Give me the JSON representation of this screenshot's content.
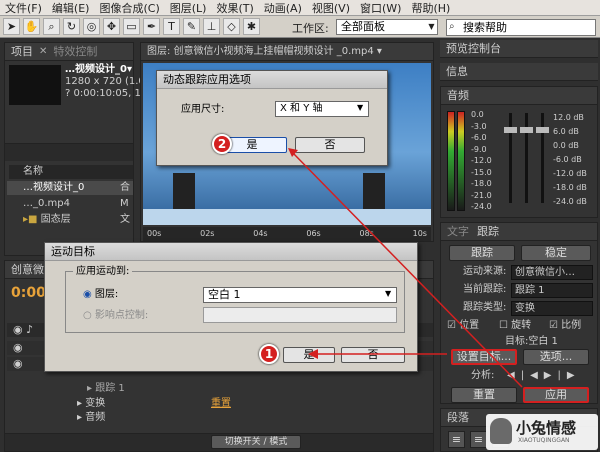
{
  "menu": [
    "文件(F)",
    "编辑(E)",
    "图像合成(C)",
    "图层(L)",
    "效果(T)",
    "动画(A)",
    "视图(V)",
    "窗口(W)",
    "帮助(H)"
  ],
  "toolbar": {
    "workspace_label": "工作区:",
    "workspace_value": "全部面板",
    "search_placeholder": "搜索帮助"
  },
  "project": {
    "tab1": "项目",
    "tab2": "特效控制",
    "thumb_name": "…视频设计_0▾",
    "thumb_size": "1280 x 720 (1.00)",
    "thumb_dur": "? 0:00:10:05, 15…",
    "col_name": "名称",
    "items": [
      {
        "name": "…视频设计_0",
        "type": "合"
      },
      {
        "name": "…_0.mp4",
        "type": "M"
      },
      {
        "name": "固态层",
        "type": "文"
      }
    ]
  },
  "viewer": {
    "tab": "图层: 创意微信小视频海上挂帽帽视频设计 _0.mp4 ▾",
    "ruler": [
      "00s",
      "02s",
      "04s",
      "06s",
      "08s",
      "10s"
    ]
  },
  "right": {
    "preview_tab": "预览控制台",
    "info_tab": "信息",
    "audio_tab": "音频",
    "db_left": [
      "0.0",
      "-3.0",
      "-6.0",
      "-9.0",
      "-12.0",
      "-15.0",
      "-18.0",
      "-21.0",
      "-24.0"
    ],
    "db_right": [
      "12.0 dB",
      "6.0 dB",
      "0.0 dB",
      "-6.0 dB",
      "-12.0 dB",
      "-18.0 dB",
      "-24.0 dB"
    ]
  },
  "tracker": {
    "tab_text": "文字",
    "tab_tracker": "跟踪",
    "track_btn": "跟踪",
    "stabilize_btn": "稳定",
    "source_label": "运动来源:",
    "source_value": "创意微信小…",
    "current_label": "当前跟踪:",
    "current_value": "跟踪 1",
    "type_label": "跟踪类型:",
    "type_value": "变换",
    "chk_pos": "位置",
    "chk_rot": "旋转",
    "chk_scale": "比例",
    "target_label": "目标:空白 1",
    "set_target_btn": "设置目标...",
    "options_btn": "选项...",
    "analyze_label": "分析:",
    "reset_btn": "重置",
    "apply_btn": "应用"
  },
  "paragraph": {
    "tab": "段落"
  },
  "timeline": {
    "comp_tab": "创意微",
    "timecode": "0:00:",
    "track_row": "跟踪 1",
    "transform_row": "变换",
    "reset_link": "重置",
    "audio_row": "音频",
    "toggle_label": "切换开关 / 模式"
  },
  "dialog_apply": {
    "title": "动态跟踪应用选项",
    "label": "应用尺寸:",
    "value": "X 和 Y 轴",
    "yes": "是",
    "no": "否"
  },
  "dialog_target": {
    "title": "运动目标",
    "group": "应用运动到:",
    "layer_label": "图层:",
    "layer_value": "空白 1",
    "effect_label": "影响点控制:",
    "yes": "是",
    "no": "否"
  },
  "markers": {
    "m1": "1",
    "m2": "2"
  },
  "watermark": {
    "brand": "小兔情感",
    "url": "XIAOTUQINGGAN"
  }
}
